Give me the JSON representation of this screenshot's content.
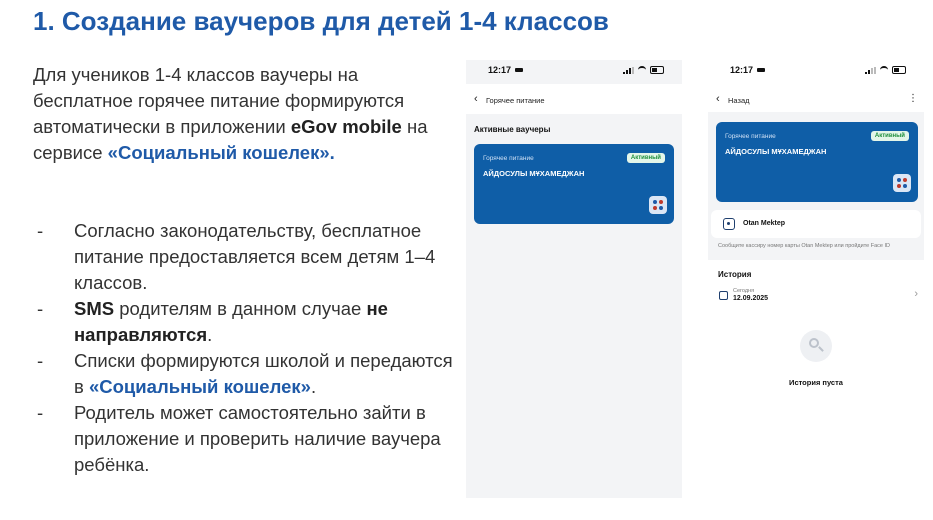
{
  "title": "1. Создание ваучеров для детей 1-4 классов",
  "intro": {
    "part1": "Для учеников 1-4 классов ваучеры на бесплатное горячее питание формируются автоматически в приложении ",
    "app_name": "eGov mobile",
    "part2": " на сервисе ",
    "service": "«Социальный кошелек»."
  },
  "bullets": [
    {
      "dash": "-",
      "text": "Согласно законодательству, бесплатное питание предоставляется всем детям 1–4 классов."
    },
    {
      "dash": "-",
      "sms": "SMS",
      "mid": " родителям в данном случае ",
      "bold_end": "не направляются",
      "end": "."
    },
    {
      "dash": "-",
      "pre": "Списки формируются школой и передаются в ",
      "service": "«Социальный кошелек»",
      "end": "."
    },
    {
      "dash": "-",
      "text": "Родитель может самостоятельно зайти в приложение и проверить наличие ваучера ребёнка."
    }
  ],
  "phone1": {
    "time": "12:17",
    "back_icon": "chevron-left-icon",
    "nav_title": "Горячее питание",
    "section": "Активные ваучеры",
    "card": {
      "sub": "Горячее питание",
      "name": "АЙДОСУЛЫ МҰХАМЕДЖАН",
      "badge": "Активный"
    }
  },
  "phone2": {
    "time": "12:17",
    "nav_title": "Назад",
    "menu": "⋮",
    "card": {
      "sub": "Горячее питание",
      "name": "АЙДОСУЛЫ МҰХАМЕДЖАН",
      "badge": "Активный"
    },
    "otan_label": "Otan Mektep",
    "hint": "Сообщите кассиру номер карты Otan Mektep или пройдите Face ID",
    "history_title": "История",
    "history_sub": "Сегодня",
    "history_date": "12.09.2025",
    "empty_text": "История пуста"
  },
  "colors": {
    "title": "#1f5aa8",
    "card": "#0f5ea7",
    "badge_text": "#1d8f3b"
  }
}
